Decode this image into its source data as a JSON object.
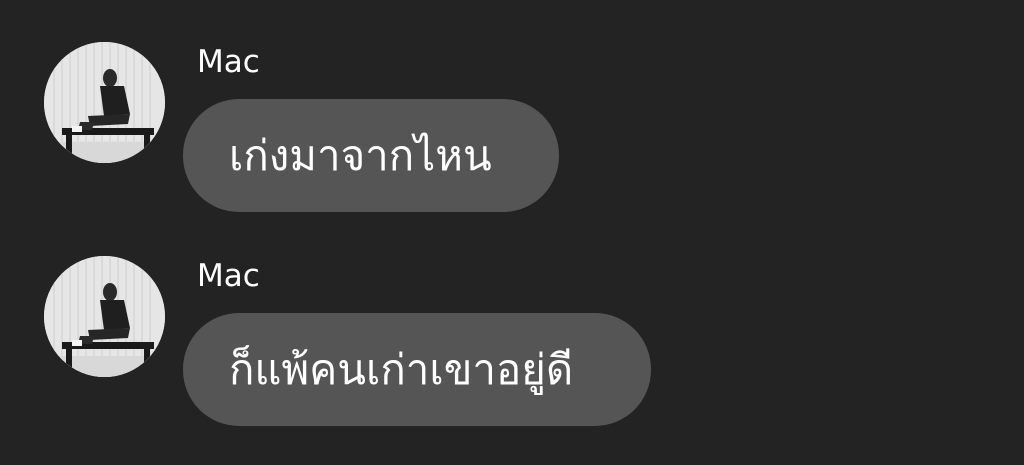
{
  "colors": {
    "background": "#232323",
    "bubble": "#555555",
    "text": "#ffffff"
  },
  "messages": [
    {
      "sender": "Mac",
      "avatar_icon": "person-sitting-photo-avatar",
      "text": "เก่งมาจากไหน"
    },
    {
      "sender": "Mac",
      "avatar_icon": "person-sitting-photo-avatar",
      "text": "ก็แพ้คนเก่าเขาอยู่ดี"
    }
  ]
}
